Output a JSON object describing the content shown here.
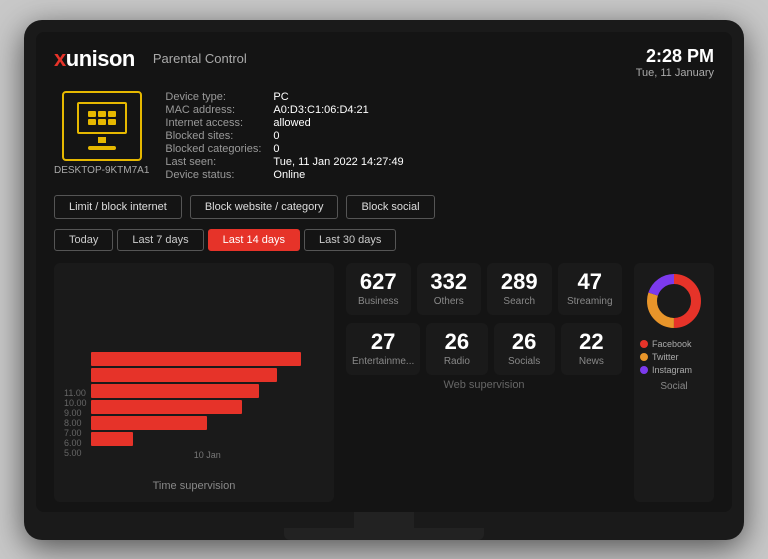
{
  "app": {
    "logo": "xunison",
    "logo_x": "x",
    "logo_rest": "unison",
    "title": "Parental Control",
    "time": "2:28 PM",
    "date": "Tue, 11 January"
  },
  "device": {
    "icon_label": "DESKTOP-9KTM7A1",
    "fields": [
      {
        "label": "Device type:",
        "value": "PC"
      },
      {
        "label": "MAC address:",
        "value": "A0:D3:C1:06:D4:21"
      },
      {
        "label": "Internet access:",
        "value": "allowed"
      },
      {
        "label": "Blocked sites:",
        "value": "0"
      },
      {
        "label": "Blocked categories:",
        "value": "0"
      },
      {
        "label": "Last seen:",
        "value": "Tue, 11 Jan 2022 14:27:49"
      },
      {
        "label": "Device status:",
        "value": "Online"
      }
    ]
  },
  "action_buttons": [
    {
      "label": "Limit / block internet",
      "id": "limit-block"
    },
    {
      "label": "Block website / category",
      "id": "block-website"
    },
    {
      "label": "Block social",
      "id": "block-social"
    }
  ],
  "time_tabs": [
    {
      "label": "Today",
      "active": false
    },
    {
      "label": "Last 7 days",
      "active": false
    },
    {
      "label": "Last 14 days",
      "active": true
    },
    {
      "label": "Last 30 days",
      "active": false
    }
  ],
  "chart": {
    "title": "Time supervision",
    "x_label": "10 Jan",
    "y_labels": [
      "11.00",
      "10.00",
      "9.00",
      "8.00",
      "7.00",
      "6.00",
      "5.00"
    ],
    "bars": [
      {
        "width_pct": 95,
        "label": ""
      },
      {
        "width_pct": 85,
        "label": ""
      },
      {
        "width_pct": 80,
        "label": ""
      },
      {
        "width_pct": 75,
        "label": ""
      },
      {
        "width_pct": 60,
        "label": ""
      },
      {
        "width_pct": 20,
        "label": ""
      }
    ]
  },
  "web_supervision": {
    "title": "Web supervision",
    "stats": [
      {
        "number": "627",
        "label": "Business"
      },
      {
        "number": "332",
        "label": "Others"
      },
      {
        "number": "289",
        "label": "Search"
      },
      {
        "number": "47",
        "label": "Streaming"
      },
      {
        "number": "27",
        "label": "Entertainme..."
      },
      {
        "number": "26",
        "label": "Radio"
      },
      {
        "number": "26",
        "label": "Socials"
      },
      {
        "number": "22",
        "label": "News"
      }
    ]
  },
  "social": {
    "title": "Social",
    "legend": [
      {
        "label": "Facebook",
        "color": "#e63329"
      },
      {
        "label": "Twitter",
        "color": "#e8952a"
      },
      {
        "label": "Instagram",
        "color": "#7c3aed"
      }
    ],
    "donut": {
      "segments": [
        {
          "value": 50,
          "color": "#e63329"
        },
        {
          "value": 30,
          "color": "#e8952a"
        },
        {
          "value": 20,
          "color": "#7c3aed"
        }
      ]
    }
  }
}
